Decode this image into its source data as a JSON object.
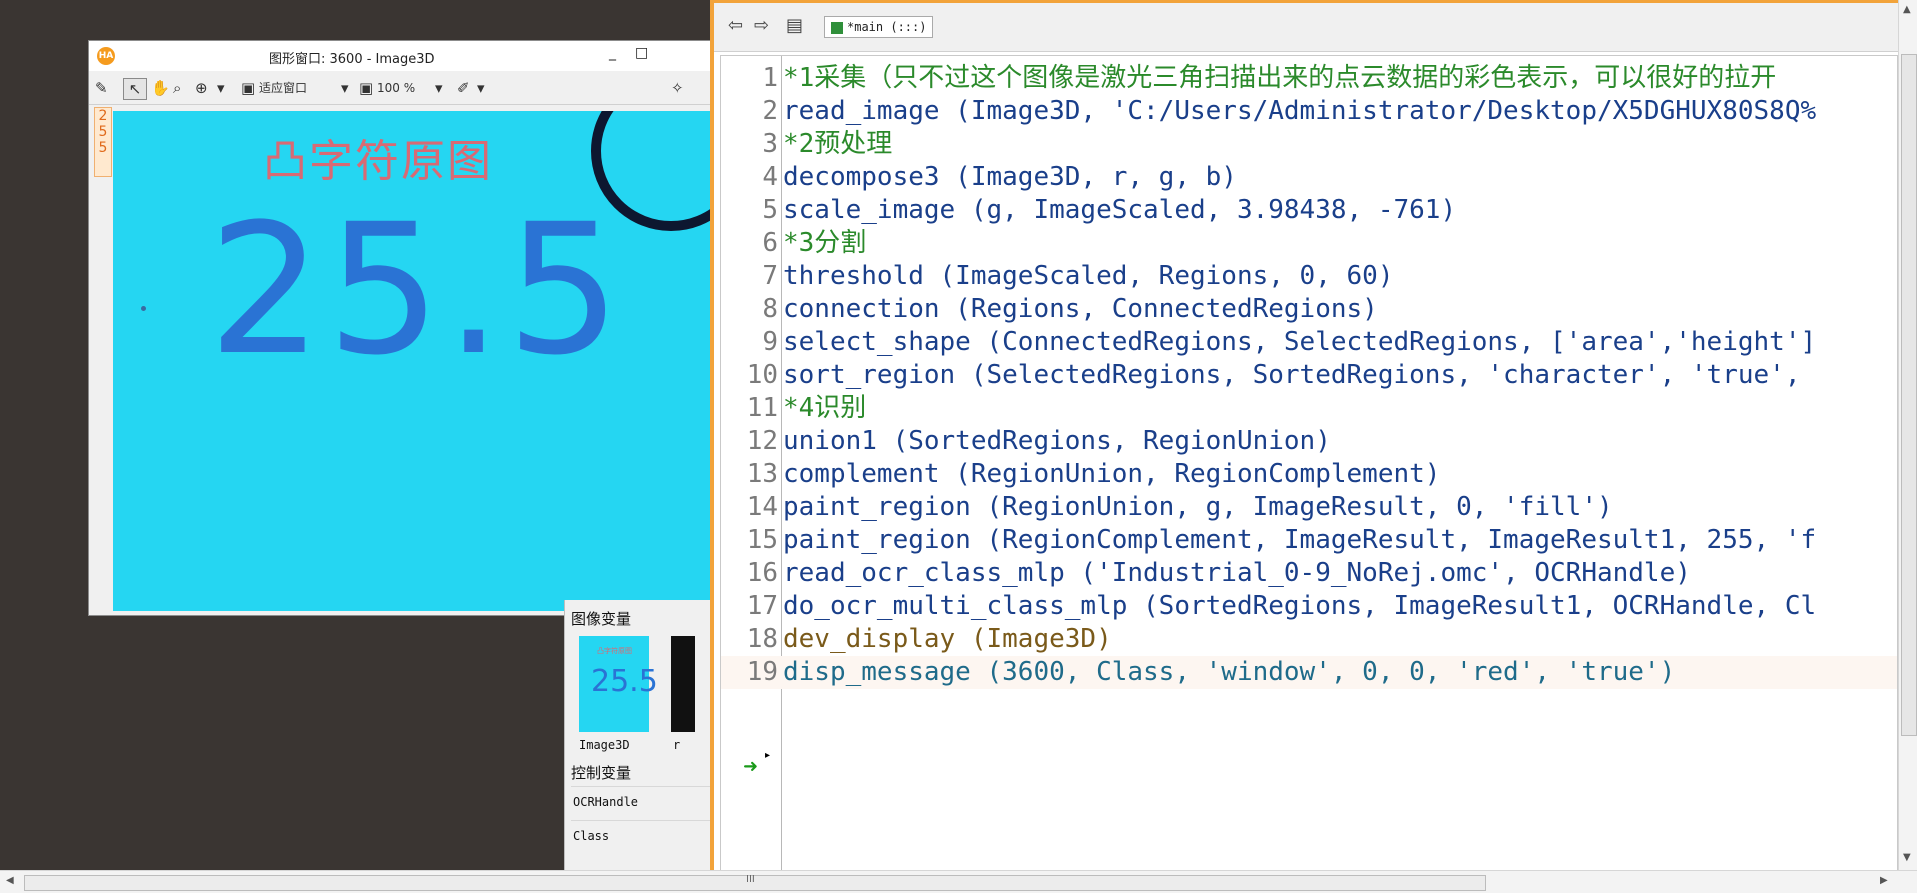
{
  "graphics_window": {
    "logo": "HA",
    "title": "图形窗口: 3600 - Image3D",
    "minimize": "_",
    "maximize": "□",
    "toolbar": {
      "fit_window": "适应窗口",
      "zoom": "100 %"
    },
    "gutter": [
      "2",
      "5",
      "5"
    ],
    "canvas_label": "凸字符原图",
    "canvas_digits": "25.5"
  },
  "variables_panel": {
    "image_section": "图像变量",
    "thumbnail_label_top": "凸字符原图",
    "thumbnail_digits": "25.5",
    "image_vars": [
      "Image3D",
      "r"
    ],
    "control_section": "控制变量",
    "control_vars": [
      "OCRHandle",
      "Class"
    ]
  },
  "editor": {
    "tab_label": "*main (:::)",
    "lines": [
      {
        "n": "1",
        "text": "*1采集（只不过这个图像是激光三角扫描出来的点云数据的彩色表示，可以很好的拉开"
      },
      {
        "n": "2",
        "text": "read_image (Image3D, 'C:/Users/Administrator/Desktop/X5DGHUX80S8Q%"
      },
      {
        "n": "3",
        "text": "*2预处理"
      },
      {
        "n": "4",
        "text": "decompose3 (Image3D, r, g, b)"
      },
      {
        "n": "5",
        "text": "scale_image (g, ImageScaled, 3.98438, -761)"
      },
      {
        "n": "6",
        "text": "*3分割"
      },
      {
        "n": "7",
        "text": "threshold (ImageScaled, Regions, 0, 60)"
      },
      {
        "n": "8",
        "text": "connection (Regions, ConnectedRegions)"
      },
      {
        "n": "9",
        "text": "select_shape (ConnectedRegions, SelectedRegions, ['area','height']"
      },
      {
        "n": "10",
        "text": "sort_region (SelectedRegions, SortedRegions, 'character', 'true',"
      },
      {
        "n": "11",
        "text": "*4识别"
      },
      {
        "n": "12",
        "text": "union1 (SortedRegions, RegionUnion)"
      },
      {
        "n": "13",
        "text": "complement (RegionUnion, RegionComplement)"
      },
      {
        "n": "14",
        "text": "paint_region (RegionUnion, g, ImageResult, 0, 'fill')"
      },
      {
        "n": "15",
        "text": "paint_region (RegionComplement, ImageResult, ImageResult1, 255, 'f"
      },
      {
        "n": "16",
        "text": "read_ocr_class_mlp ('Industrial_0-9_NoRej.omc', OCRHandle)"
      },
      {
        "n": "17",
        "text": "do_ocr_multi_class_mlp (SortedRegions, ImageResult1, OCRHandle, Cl"
      },
      {
        "n": "18",
        "text": "dev_display (Image3D)"
      },
      {
        "n": "19",
        "text": "disp_message (3600, Class, 'window', 0, 0, 'red', 'true')"
      }
    ]
  },
  "scrollbar": {
    "grip": "III"
  }
}
